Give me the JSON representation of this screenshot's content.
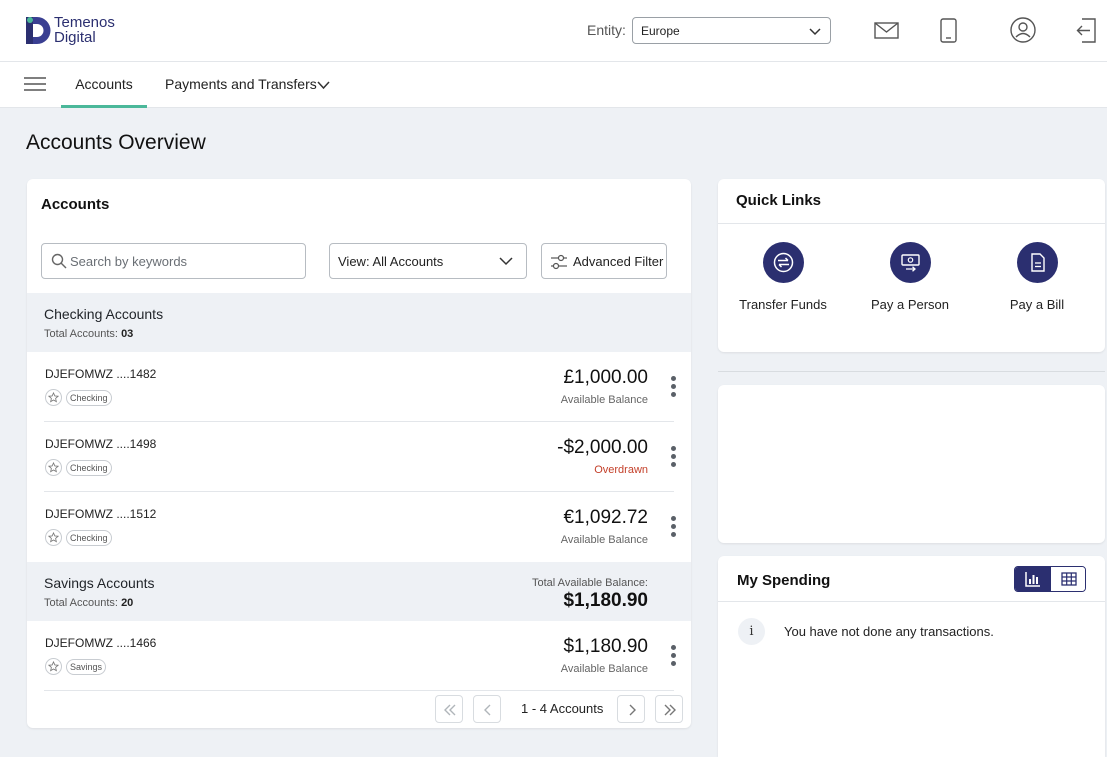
{
  "brand": {
    "line1": "Temenos",
    "line2": "Digital",
    "color": "#2b2f70",
    "accent": "#4bb89a"
  },
  "header": {
    "entity_label": "Entity:",
    "entity_value": "Europe",
    "icons": [
      "mail-icon",
      "mobile-icon",
      "profile-icon",
      "logout-icon"
    ]
  },
  "nav": {
    "tabs": [
      {
        "label": "Accounts",
        "active": true
      },
      {
        "label": "Payments and Transfers",
        "active": false
      }
    ]
  },
  "page_title": "Accounts Overview",
  "accounts_card": {
    "title": "Accounts",
    "search_placeholder": "Search by keywords",
    "view_label": "View:",
    "view_value": "All Accounts",
    "advanced_filter": "Advanced Filter",
    "groups": [
      {
        "name": "Checking Accounts",
        "count_label": "Total Accounts:",
        "count": "03",
        "accounts": [
          {
            "name": "DJEFOMWZ ....1482",
            "type": "Checking",
            "amount": "£1,000.00",
            "sub": "Available Balance"
          },
          {
            "name": "DJEFOMWZ ....1498",
            "type": "Checking",
            "amount": "-$2,000.00",
            "sub": "Overdrawn"
          },
          {
            "name": "DJEFOMWZ ....1512",
            "type": "Checking",
            "amount": "€1,092.72",
            "sub": "Available Balance"
          }
        ]
      },
      {
        "name": "Savings Accounts",
        "count_label": "Total Accounts:",
        "count": "20",
        "total_label": "Total Available Balance:",
        "total_value": "$1,180.90",
        "accounts": [
          {
            "name": "DJEFOMWZ ....1466",
            "type": "Savings",
            "amount": "$1,180.90",
            "sub": "Available Balance"
          }
        ]
      }
    ],
    "pagination": "1 - 4 Accounts"
  },
  "quick_links": {
    "title": "Quick Links",
    "items": [
      {
        "label": "Transfer Funds",
        "icon": "transfer-icon"
      },
      {
        "label": "Pay a Person",
        "icon": "pay-person-icon"
      },
      {
        "label": "Pay a Bill",
        "icon": "bill-icon"
      }
    ]
  },
  "my_spending": {
    "title": "My Spending",
    "info_glyph": "i",
    "empty_message": "You have not done any transactions."
  }
}
